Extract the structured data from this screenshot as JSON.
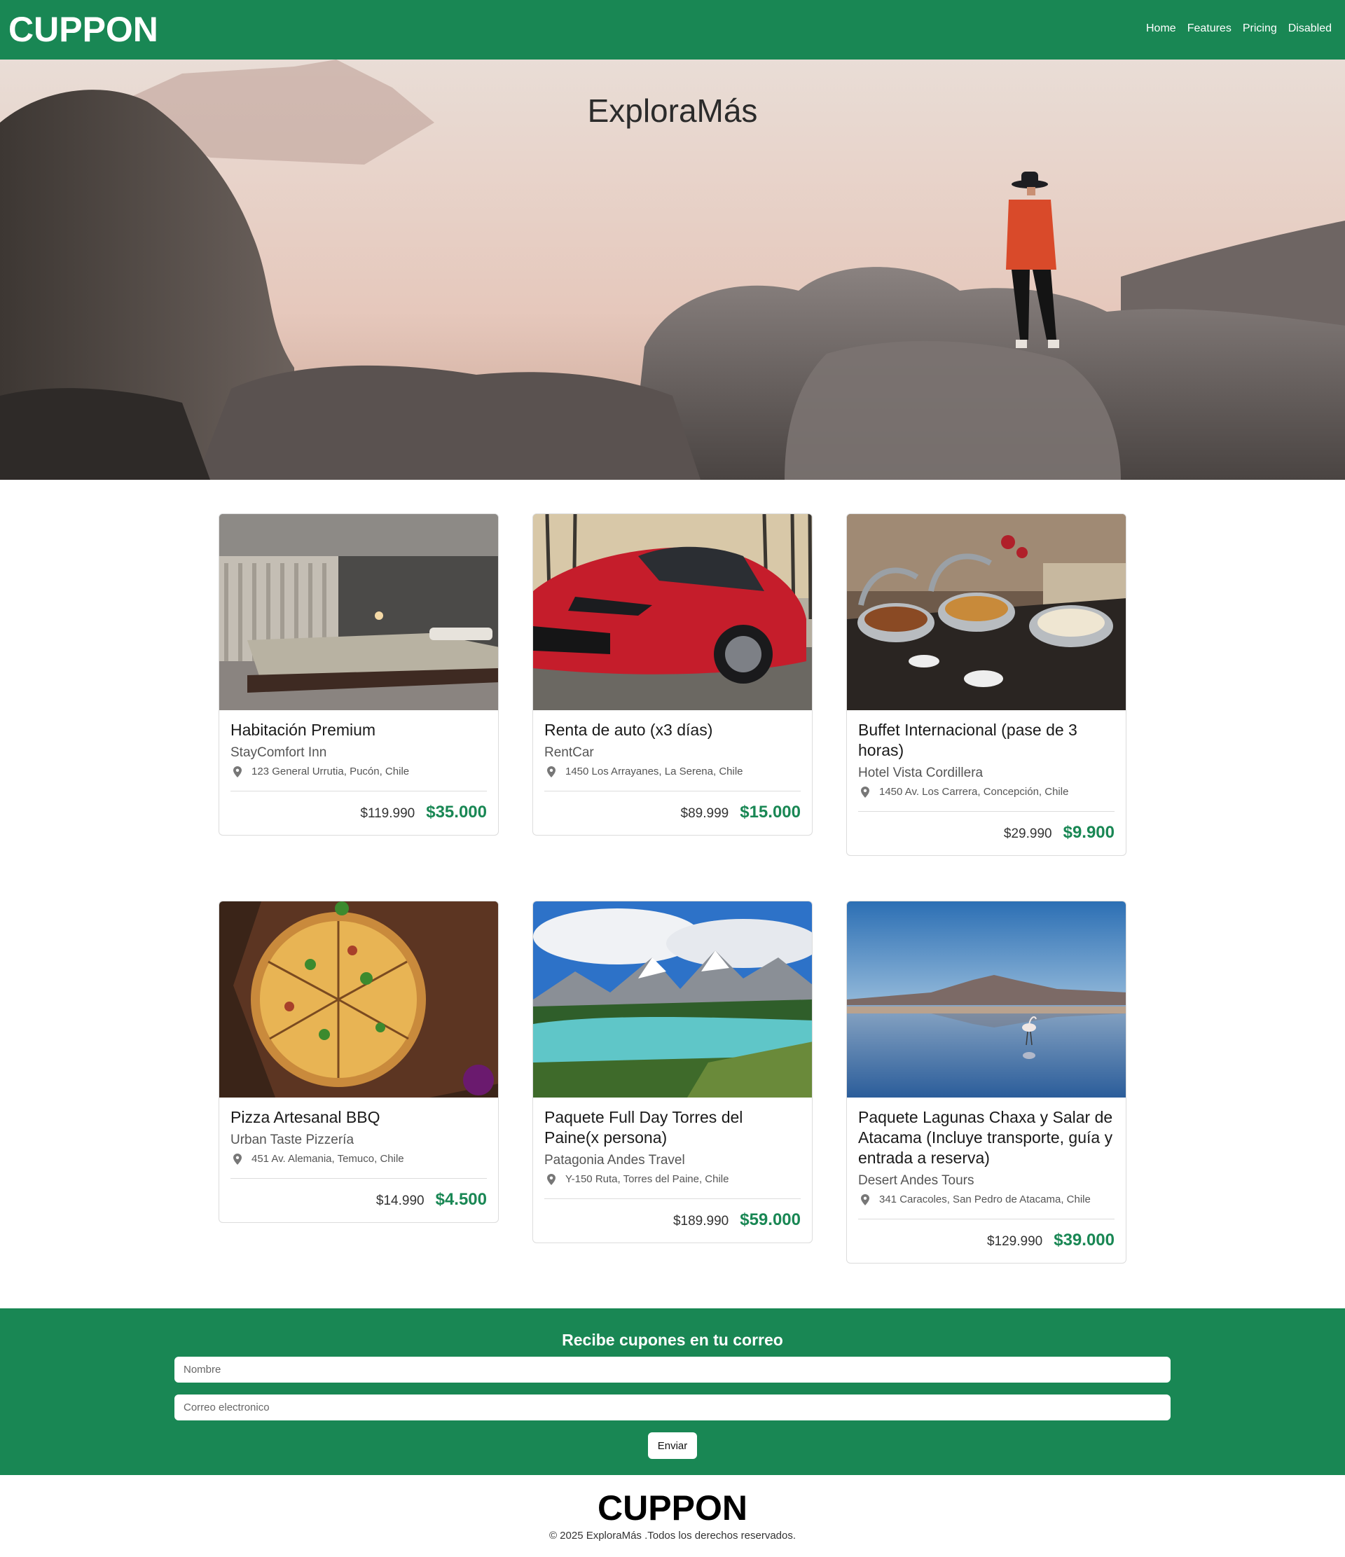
{
  "navbar": {
    "brand": "CUPPON",
    "links": [
      "Home",
      "Features",
      "Pricing",
      "Disabled"
    ]
  },
  "hero": {
    "title": "ExploraMás"
  },
  "cards": [
    {
      "title": "Habitación Premium",
      "vendor": "StayComfort Inn",
      "address": "123 General Urrutia, Pucón, Chile",
      "old_price": "$119.990",
      "new_price": "$35.000",
      "image": "hotel-room"
    },
    {
      "title": "Renta de auto (x3 días)",
      "vendor": "RentCar",
      "address": "1450 Los Arrayanes, La Serena, Chile",
      "old_price": "$89.999",
      "new_price": "$15.000",
      "image": "red-car"
    },
    {
      "title": "Buffet Internacional (pase de 3 horas)",
      "vendor": "Hotel Vista Cordillera",
      "address": "1450 Av. Los Carrera, Concepción, Chile",
      "old_price": "$29.990",
      "new_price": "$9.900",
      "image": "buffet"
    },
    {
      "title": "Pizza Artesanal BBQ",
      "vendor": "Urban Taste Pizzería",
      "address": "451 Av. Alemania, Temuco, Chile",
      "old_price": "$14.990",
      "new_price": "$4.500",
      "image": "pizza"
    },
    {
      "title": "Paquete Full Day Torres del Paine(x persona)",
      "vendor": "Patagonia Andes Travel",
      "address": "Y-150 Ruta, Torres del Paine, Chile",
      "old_price": "$189.990",
      "new_price": "$59.000",
      "image": "torres-del-paine"
    },
    {
      "title": "Paquete Lagunas Chaxa y Salar de Atacama (Incluye transporte, guía y entrada a reserva)",
      "vendor": "Desert Andes Tours",
      "address": "341 Caracoles, San Pedro de Atacama, Chile",
      "old_price": "$129.990",
      "new_price": "$39.000",
      "image": "salar-flamingo"
    }
  ],
  "newsletter": {
    "title": "Recibe cupones en tu correo",
    "name_placeholder": "Nombre",
    "email_placeholder": "Correo electronico",
    "submit_label": "Enviar"
  },
  "footer": {
    "brand": "CUPPON",
    "copyright": "© 2025 ExploraMás .Todos los derechos reservados."
  },
  "colors": {
    "brand_green": "#198754",
    "price_green": "#198754"
  },
  "icons": {
    "address": "map-pin-icon"
  }
}
